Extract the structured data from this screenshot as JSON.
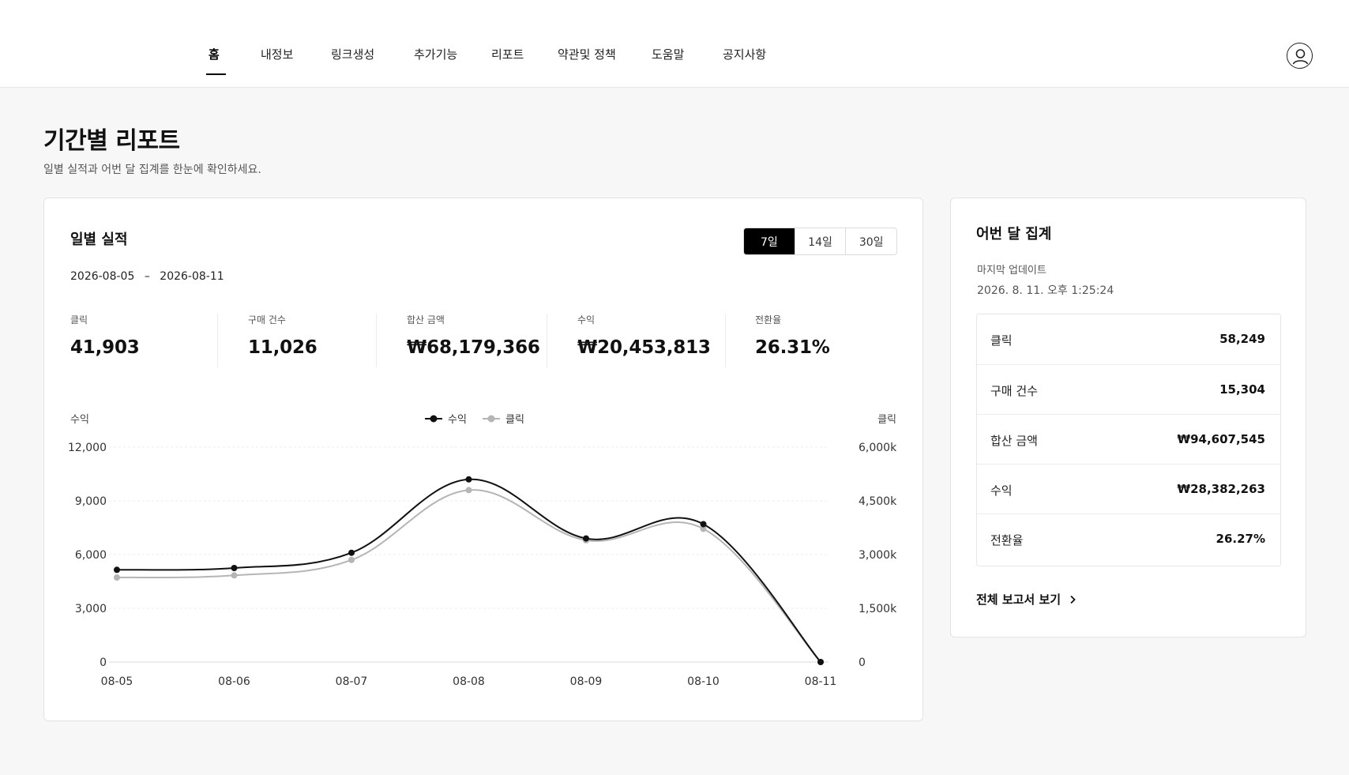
{
  "nav": {
    "items": [
      {
        "label": "홈",
        "active": true
      },
      {
        "label": "내정보"
      },
      {
        "label": "링크생성"
      },
      {
        "label": "추가기능"
      },
      {
        "label": "리포트"
      },
      {
        "label": "약관및 정책"
      },
      {
        "label": "도움말"
      },
      {
        "label": "공지사항"
      }
    ],
    "profile_icon": "user-circle-icon"
  },
  "page": {
    "title": "기간별 리포트",
    "subtitle": "일별 실적과 어번 달 집계를 한눈에 확인하세요."
  },
  "daily": {
    "title": "일별 실적",
    "range_tabs": [
      "7일",
      "14일",
      "30일"
    ],
    "active_range": "7일",
    "date_start": "2026-08-05",
    "date_sep": "–",
    "date_end": "2026-08-11",
    "stats": [
      {
        "label": "클릭",
        "value": "41,903"
      },
      {
        "label": "구매 건수",
        "value": "11,026"
      },
      {
        "label": "합산 금액",
        "value": "₩68,179,366"
      },
      {
        "label": "수익",
        "value": "₩20,453,813"
      },
      {
        "label": "전환율",
        "value": "26.31%"
      }
    ]
  },
  "chart_data": {
    "type": "line",
    "x": [
      "08-05",
      "08-06",
      "08-07",
      "08-08",
      "08-09",
      "08-10",
      "08-11"
    ],
    "y_left_label": "수익",
    "y_right_label": "클릭",
    "y_left_ticks": [
      "0",
      "3,000",
      "6,000",
      "9,000",
      "12,000"
    ],
    "y_right_ticks": [
      "0",
      "1,500k",
      "3,000k",
      "4,500k",
      "6,000k"
    ],
    "ylim_left": [
      0,
      12000
    ],
    "ylim_right": [
      0,
      6000
    ],
    "grid": true,
    "legend_position": "top-center",
    "series": [
      {
        "name": "수익",
        "axis": "left",
        "color": "#111111",
        "values": [
          5150,
          5250,
          6100,
          10200,
          6900,
          7700,
          0
        ]
      },
      {
        "name": "클릭",
        "axis": "right",
        "color": "#b5b5b5",
        "values": [
          2360,
          2420,
          2850,
          4800,
          3400,
          3720,
          0
        ]
      }
    ]
  },
  "monthly": {
    "title": "어번 달 집계",
    "update_label": "마지막 업데이트",
    "update_time": "2026. 8. 11. 오후 1:25:24",
    "rows": [
      {
        "label": "클릭",
        "value": "58,249"
      },
      {
        "label": "구매 건수",
        "value": "15,304"
      },
      {
        "label": "합산 금액",
        "value": "₩94,607,545"
      },
      {
        "label": "수익",
        "value": "₩28,382,263"
      },
      {
        "label": "전환율",
        "value": "26.27%"
      }
    ],
    "full_report": "전체 보고서 보기"
  }
}
